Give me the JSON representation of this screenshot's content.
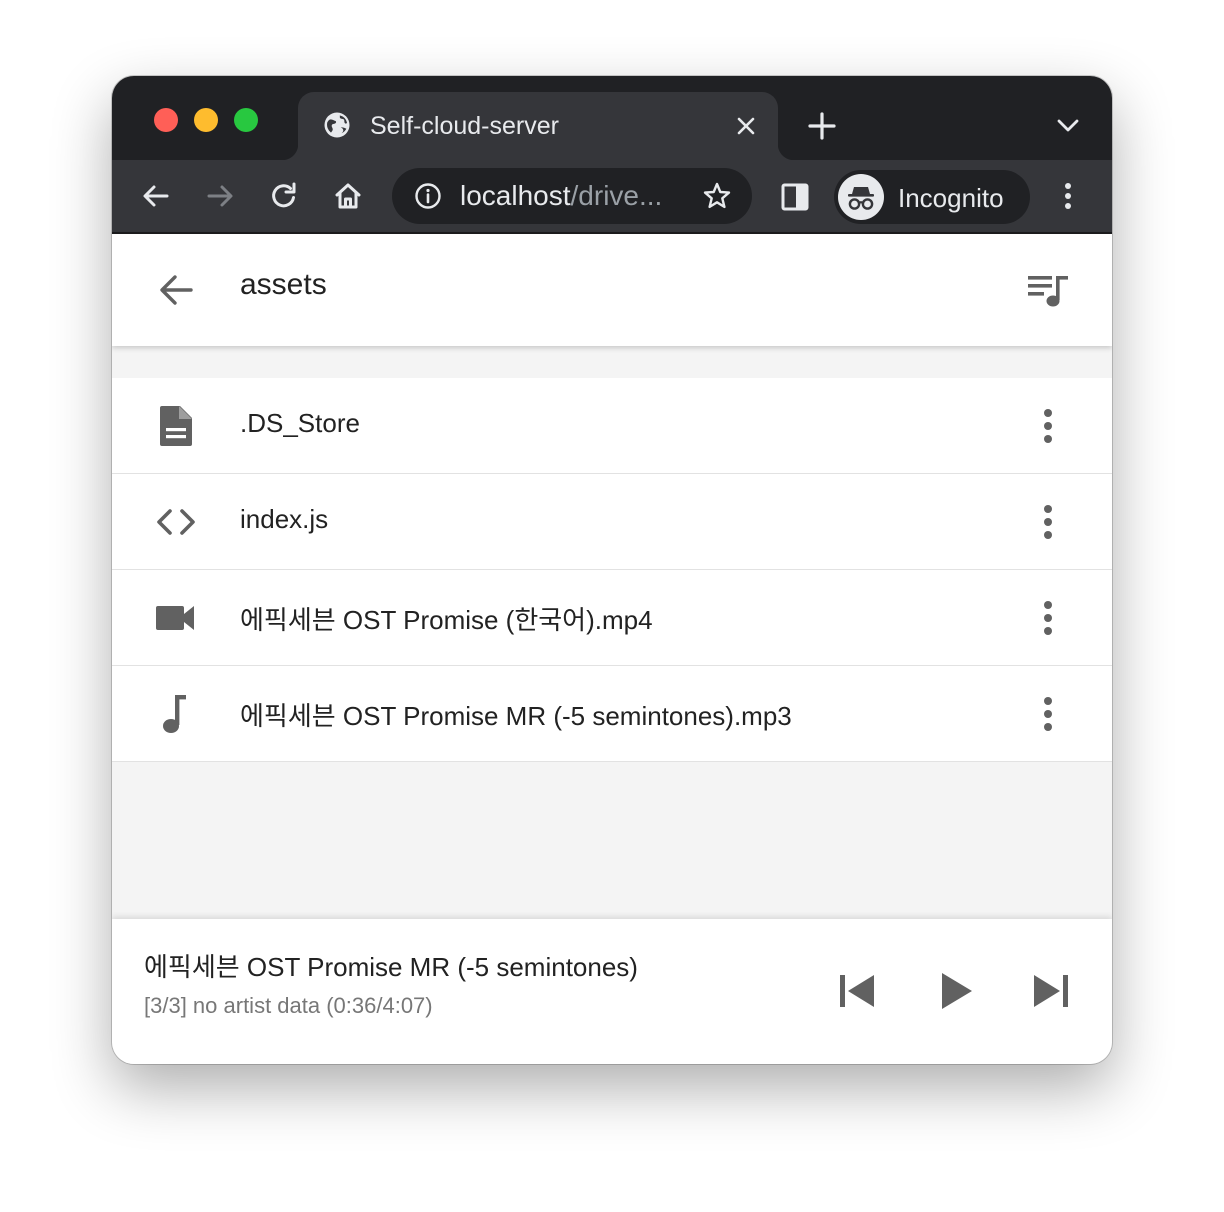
{
  "browser": {
    "tab": {
      "title": "Self-cloud-server",
      "favicon": "globe-icon"
    },
    "omnibox": {
      "host": "localhost",
      "path": "/drive..."
    },
    "profile": {
      "label": "Incognito",
      "icon": "incognito-icon"
    }
  },
  "header": {
    "title": "assets",
    "back_icon": "arrow-back-icon",
    "queue_icon": "queue-music-icon"
  },
  "files": [
    {
      "name": ".DS_Store",
      "icon": "document-icon"
    },
    {
      "name": "index.js",
      "icon": "code-icon"
    },
    {
      "name": "에픽세븐 OST Promise (한국어).mp4",
      "icon": "video-icon"
    },
    {
      "name": "에픽세븐 OST Promise MR (-5 semintones).mp3",
      "icon": "music-note-icon"
    }
  ],
  "player": {
    "title": "에픽세븐 OST Promise MR (-5 semintones)",
    "subtitle": "[3/3] no artist data (0:36/4:07)"
  },
  "colors": {
    "chrome_frame": "#202124",
    "chrome_toolbar": "#35363a",
    "icon_gray": "#616161",
    "app_background": "#f4f4f4"
  }
}
